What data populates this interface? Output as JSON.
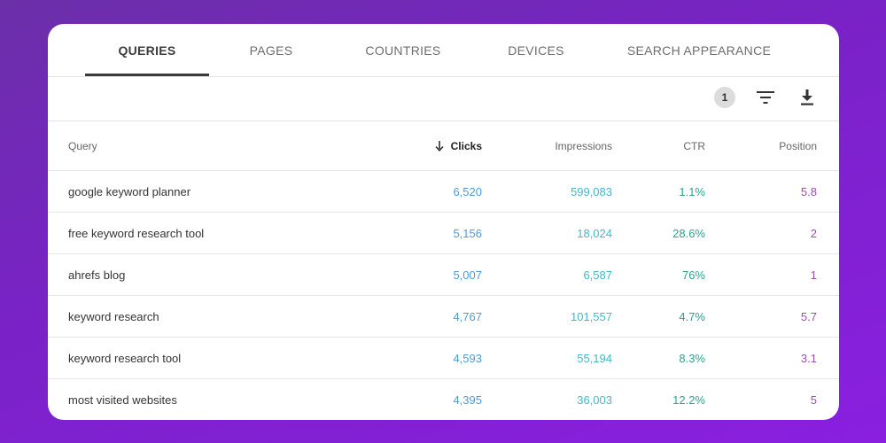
{
  "tabs": [
    {
      "label": "QUERIES",
      "active": true
    },
    {
      "label": "PAGES",
      "active": false
    },
    {
      "label": "COUNTRIES",
      "active": false
    },
    {
      "label": "DEVICES",
      "active": false
    },
    {
      "label": "SEARCH APPEARANCE",
      "active": false
    }
  ],
  "toolbar": {
    "filter_count": "1",
    "filter_icon": "filter-icon",
    "download_icon": "download-icon"
  },
  "table": {
    "headers": {
      "query": "Query",
      "clicks": "Clicks",
      "impressions": "Impressions",
      "ctr": "CTR",
      "position": "Position"
    },
    "sort_icon": "arrow-down-icon",
    "rows": [
      {
        "query": "google keyword planner",
        "clicks": "6,520",
        "impressions": "599,083",
        "ctr": "1.1%",
        "position": "5.8"
      },
      {
        "query": "free keyword research tool",
        "clicks": "5,156",
        "impressions": "18,024",
        "ctr": "28.6%",
        "position": "2"
      },
      {
        "query": "ahrefs blog",
        "clicks": "5,007",
        "impressions": "6,587",
        "ctr": "76%",
        "position": "1"
      },
      {
        "query": "keyword research",
        "clicks": "4,767",
        "impressions": "101,557",
        "ctr": "4.7%",
        "position": "5.7"
      },
      {
        "query": "keyword research tool",
        "clicks": "4,593",
        "impressions": "55,194",
        "ctr": "8.3%",
        "position": "3.1"
      },
      {
        "query": "most visited websites",
        "clicks": "4,395",
        "impressions": "36,003",
        "ctr": "12.2%",
        "position": "5"
      }
    ]
  },
  "colors": {
    "clicks": "#4f9bd6",
    "impressions": "#45b8c9",
    "ctr": "#2f9f8f",
    "position": "#9a4fb0"
  }
}
